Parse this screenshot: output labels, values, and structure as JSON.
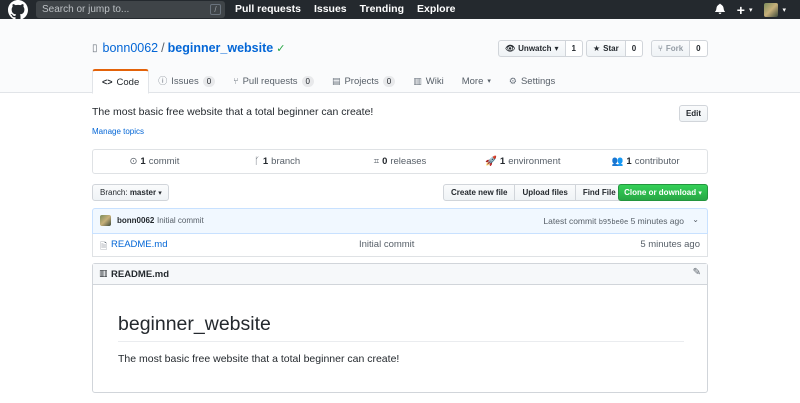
{
  "topbar": {
    "search_placeholder": "Search or jump to...",
    "slash_key": "/",
    "nav": [
      "Pull requests",
      "Issues",
      "Trending",
      "Explore"
    ],
    "plus": "+"
  },
  "repo": {
    "owner": "bonn0062",
    "separator": "/",
    "name": "beginner_website",
    "watch_label": "Unwatch",
    "watch_count": "1",
    "star_label": "Star",
    "star_count": "0",
    "fork_label": "Fork",
    "fork_count": "0"
  },
  "tabs": [
    {
      "label": "Code",
      "counter": null
    },
    {
      "label": "Issues",
      "counter": "0"
    },
    {
      "label": "Pull requests",
      "counter": "0"
    },
    {
      "label": "Projects",
      "counter": "0"
    },
    {
      "label": "Wiki",
      "counter": null
    },
    {
      "label": "More",
      "counter": null
    },
    {
      "label": "Settings",
      "counter": null
    }
  ],
  "description": "The most basic free website that a total beginner can create!",
  "manage_topics": "Manage topics",
  "edit_label": "Edit",
  "summary": {
    "commits_n": "1",
    "commits_label": "commit",
    "branches_n": "1",
    "branches_label": "branch",
    "releases_n": "0",
    "releases_label": "releases",
    "env_n": "1",
    "env_label": "environment",
    "contrib_n": "1",
    "contrib_label": "contributor"
  },
  "branch": {
    "prefix": "Branch:",
    "name": "master"
  },
  "file_buttons": [
    "Create new file",
    "Upload files",
    "Find File"
  ],
  "clone_label": "Clone or download",
  "commit": {
    "author": "bonn0062",
    "message": "Initial commit",
    "latest_prefix": "Latest commit",
    "sha": "b95be0e",
    "age": "5 minutes ago"
  },
  "files": [
    {
      "name": "README.md",
      "message": "Initial commit",
      "age": "5 minutes ago"
    }
  ],
  "readme": {
    "title": "README.md",
    "heading": "beginner_website",
    "body": "The most basic free website that a total beginner can create!"
  },
  "colors": {
    "accent": "#0366d6",
    "tab_active": "#e36209",
    "clone_green": "#28a745",
    "topbar": "#24292e"
  }
}
